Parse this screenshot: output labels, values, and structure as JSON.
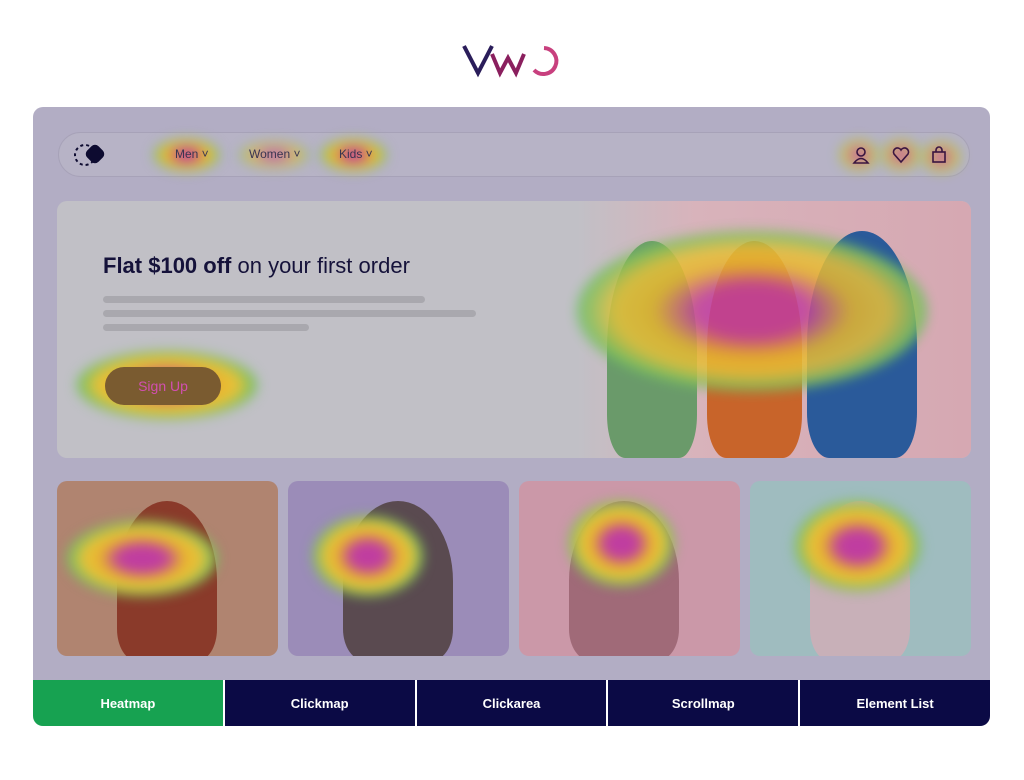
{
  "brand": {
    "logo_text": "VWO"
  },
  "nav": {
    "items": [
      {
        "label": "Men"
      },
      {
        "label": "Women"
      },
      {
        "label": "Kids"
      }
    ],
    "icons": [
      "user-icon",
      "heart-icon",
      "shopping-bag-icon"
    ]
  },
  "hero": {
    "title_bold": "Flat $100 off",
    "title_rest": " on your first order",
    "cta": "Sign Up"
  },
  "tabs": [
    {
      "label": "Heatmap",
      "active": true
    },
    {
      "label": "Clickmap"
    },
    {
      "label": "Clickarea"
    },
    {
      "label": "Scrollmap"
    },
    {
      "label": "Element List"
    }
  ],
  "colors": {
    "active_tab": "#17a251",
    "tab": "#0b0a45",
    "heat_high": "#c03da0",
    "heat_mid": "#e7b52c",
    "heat_low": "#3fbf72"
  }
}
